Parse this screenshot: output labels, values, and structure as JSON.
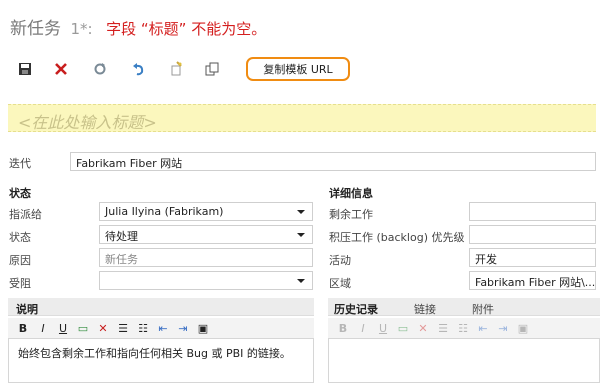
{
  "header": {
    "title": "新任务",
    "number": "1*:",
    "error": "字段 “标题” 不能为空。"
  },
  "toolbar": {
    "icons": [
      "save-icon",
      "discard-icon",
      "refresh-icon",
      "undo-icon",
      "template-icon",
      "copy-icon"
    ],
    "copy_template_url_label": "复制模板 URL"
  },
  "title_field": {
    "placeholder": "<在此处输入标题>"
  },
  "iteration": {
    "label": "迭代",
    "value": "Fabrikam Fiber 网站"
  },
  "status_section": {
    "header": "状态",
    "rows": [
      {
        "label": "指派给",
        "value": "Julia Ilyina (Fabrikam)"
      },
      {
        "label": "状态",
        "value": "待处理"
      },
      {
        "label": "原因",
        "value": "新任务"
      },
      {
        "label": "受阻",
        "value": ""
      }
    ]
  },
  "details_section": {
    "header": "详细信息",
    "rows": [
      {
        "label": "剩余工作",
        "value": ""
      },
      {
        "label": "积压工作 (backlog) 优先级",
        "value": ""
      },
      {
        "label": "活动",
        "value": "开发"
      },
      {
        "label": "区域",
        "value": "Fabrikam Fiber 网站\\..."
      }
    ]
  },
  "description": {
    "header": "说明",
    "text": "始终包含剩余工作和指向任何相关 Bug 或 PBI 的链接。"
  },
  "tabs": [
    "历史记录",
    "链接",
    "附件"
  ],
  "colors": {
    "error": "#d41f1f",
    "highlight": "#f08c12",
    "title_bg": "#fbf7bd"
  }
}
